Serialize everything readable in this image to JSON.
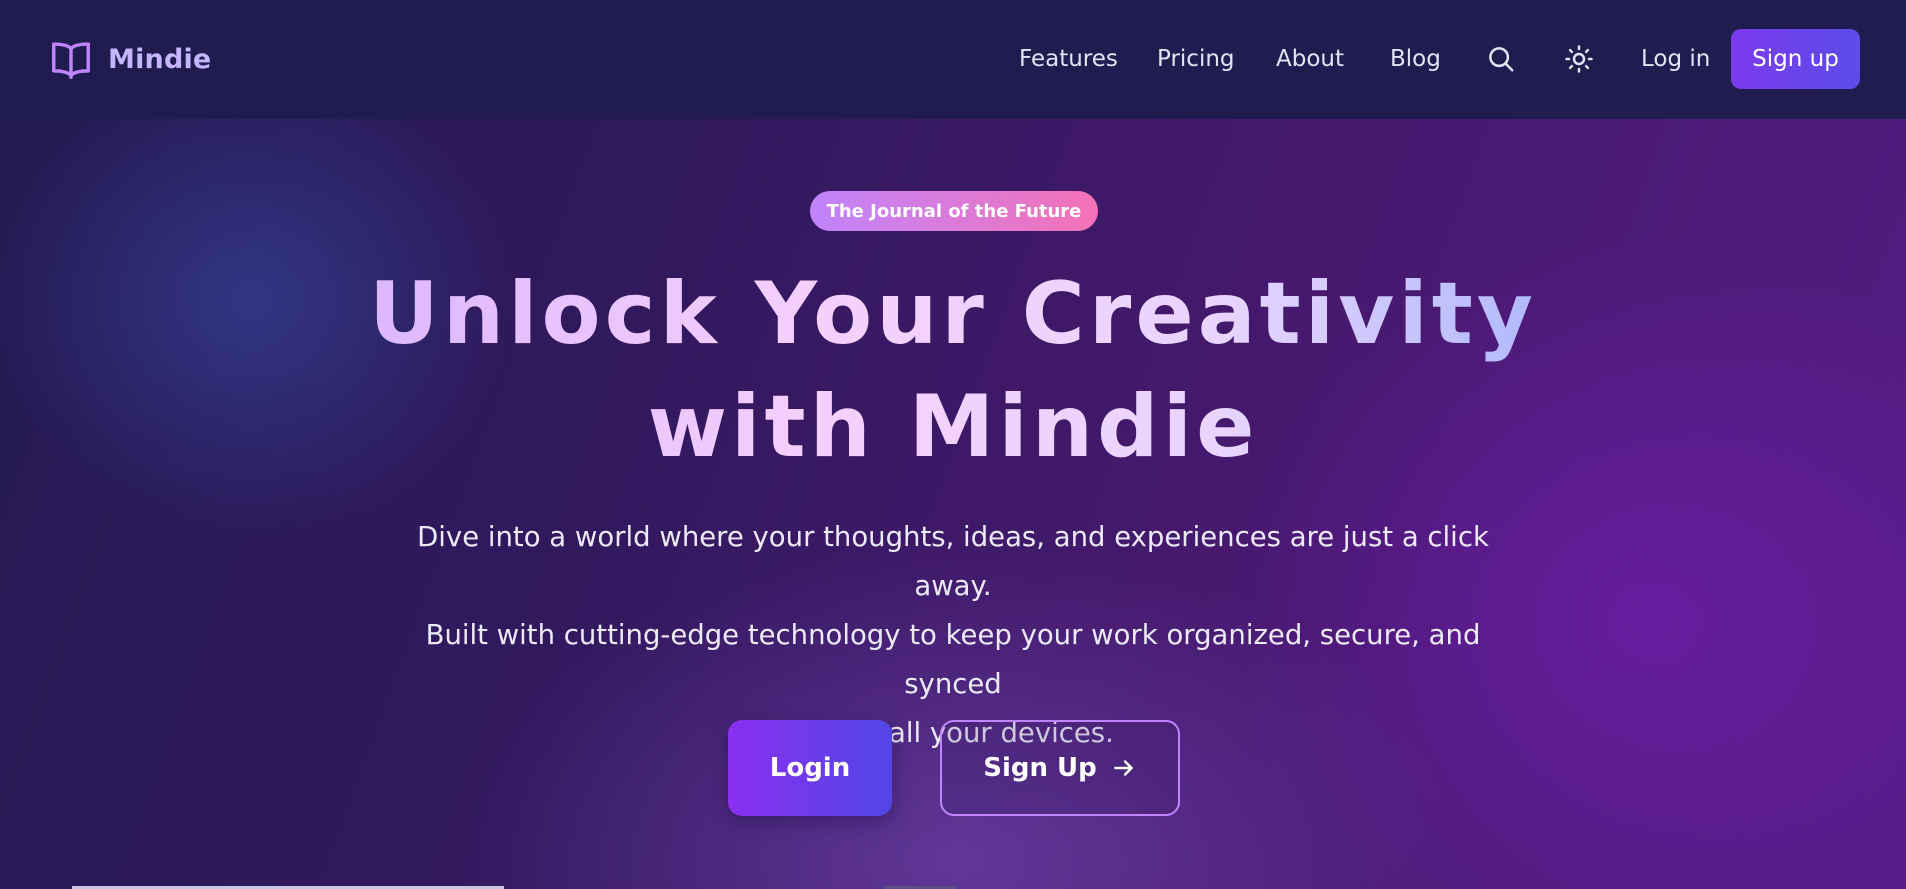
{
  "brand": {
    "name": "Mindie",
    "logo_icon": "book-open-icon"
  },
  "nav": {
    "links": [
      "Features",
      "Pricing",
      "About",
      "Blog"
    ],
    "search_icon": "search-icon",
    "theme_icon": "sun-icon",
    "login_label": "Log in",
    "signup_label": "Sign up"
  },
  "hero": {
    "badge": "The Journal of the Future",
    "headline_line1": "Unlock Your Creativity",
    "headline_line2": "with Mindie",
    "subtext_line1": "Dive into a world where your thoughts, ideas, and experiences are just a click away.",
    "subtext_line2": "Built with cutting-edge technology to keep your work organized, secure, and synced",
    "subtext_line3": "across all your devices.",
    "primary_button": "Login",
    "secondary_button": "Sign Up",
    "secondary_button_icon": "arrow-right-icon"
  },
  "colors": {
    "header_bg": "#201c4f",
    "accent_purple": "#7c3aed",
    "accent_indigo": "#5b4ce8",
    "brand_text": "#c4b5fd",
    "badge_start": "#c084fc",
    "badge_end": "#f472b6"
  }
}
